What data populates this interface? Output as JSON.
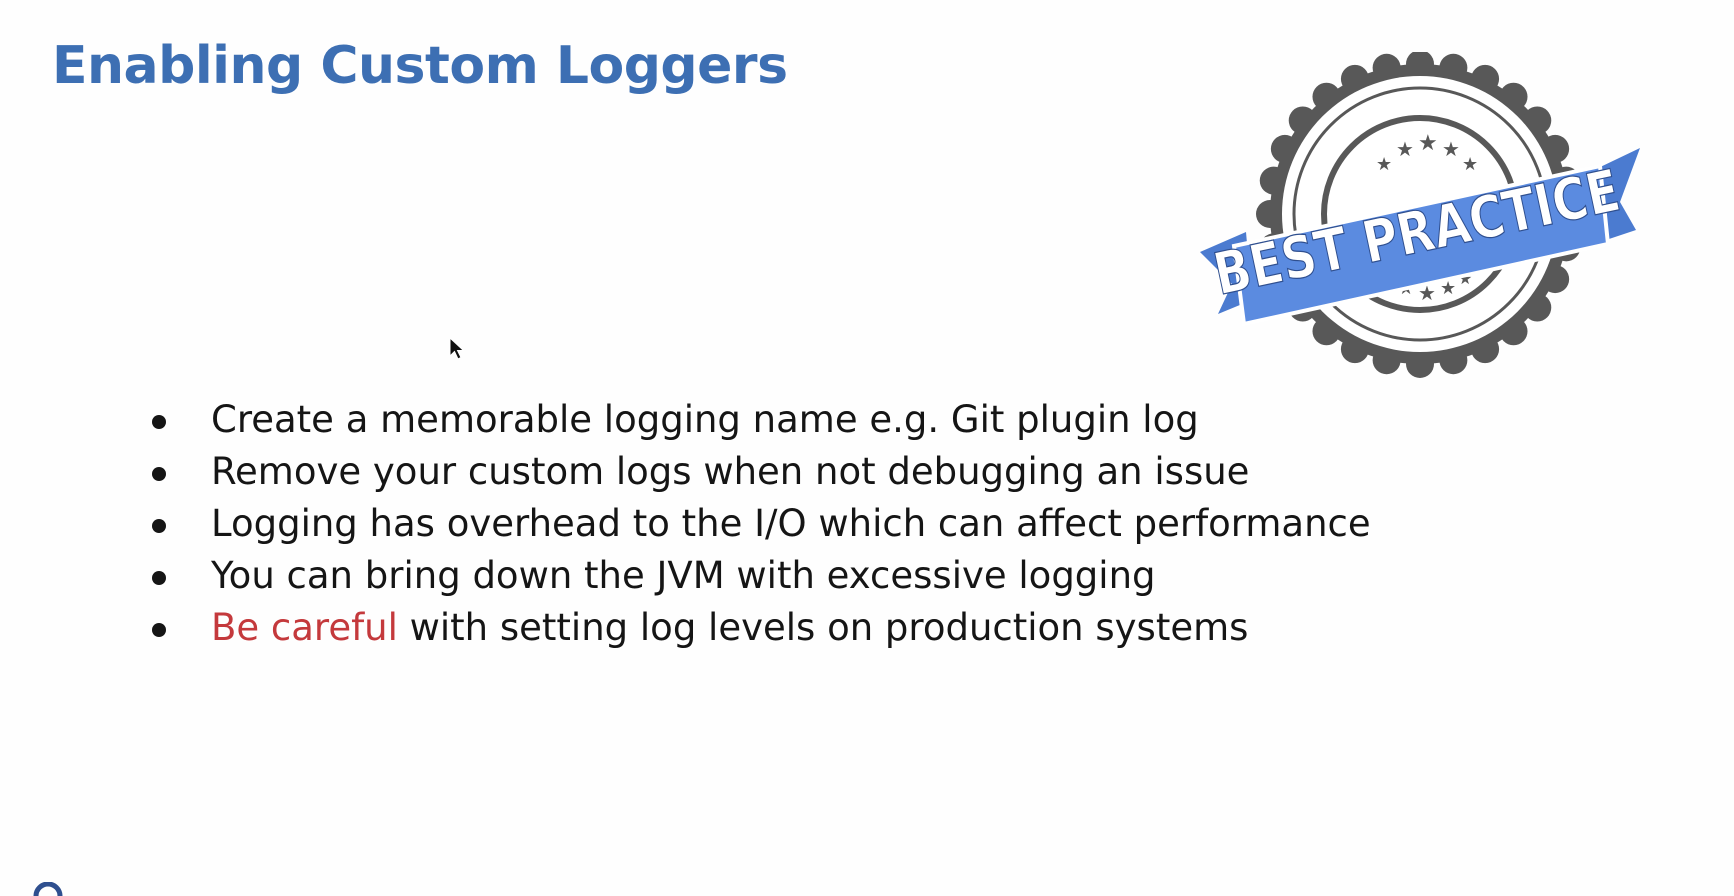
{
  "slide": {
    "title": "Enabling Custom Loggers",
    "badge": {
      "text": "BEST PRACTICE",
      "icon": "best-practice-seal"
    },
    "bullets": [
      {
        "prefix": "",
        "text": "Create a memorable logging name e.g. Git plugin log"
      },
      {
        "prefix": "",
        "text": "Remove your custom logs when not debugging an issue"
      },
      {
        "prefix": "",
        "text": "Logging has overhead to the I/O which can affect performance"
      },
      {
        "prefix": "",
        "text": "You can bring down the JVM with excessive logging"
      },
      {
        "prefix": "Be careful",
        "text": " with setting log levels on production systems"
      }
    ]
  },
  "colors": {
    "title": "#3d6fb3",
    "body_text": "#151515",
    "warning": "#c4393c",
    "ribbon": "#5b8be0",
    "seal_dark": "#555555"
  }
}
